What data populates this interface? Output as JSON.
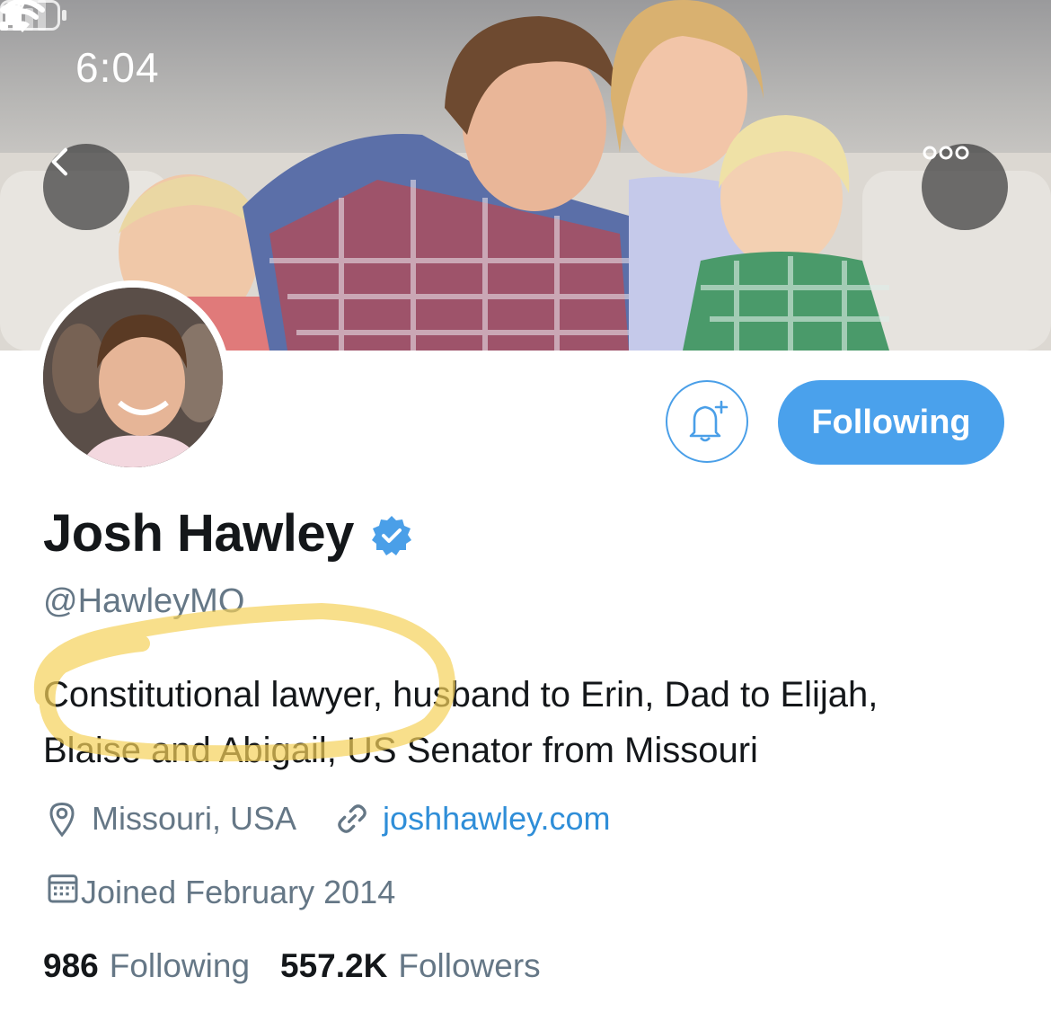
{
  "status_bar": {
    "time": "6:04",
    "location_icon": "location-arrow-icon",
    "signal_icon": "cellular-signal-icon",
    "wifi_icon": "wifi-icon",
    "battery_icon": "battery-icon"
  },
  "header": {
    "back_icon": "chevron-left-icon",
    "more_icon": "more-horizontal-icon"
  },
  "actions": {
    "notify_icon": "bell-plus-icon",
    "follow_label": "Following"
  },
  "profile": {
    "name": "Josh Hawley",
    "verified_icon": "verified-badge-icon",
    "handle": "@HawleyMO",
    "bio_line1": "Constitutional lawyer, husband to Erin, Dad to Elijah,",
    "bio_line2": "Blaise and Abigail, US Senator from Missouri",
    "location": "Missouri, USA",
    "website": "joshhawley.com",
    "joined": "Joined February 2014"
  },
  "stats": {
    "following_count": "986",
    "following_label": "Following",
    "followers_count": "557.2K",
    "followers_label": "Followers"
  },
  "colors": {
    "accent": "#4aa1ec",
    "link": "#2f8ed8",
    "muted": "#657786",
    "highlight": "#f5d25a"
  }
}
